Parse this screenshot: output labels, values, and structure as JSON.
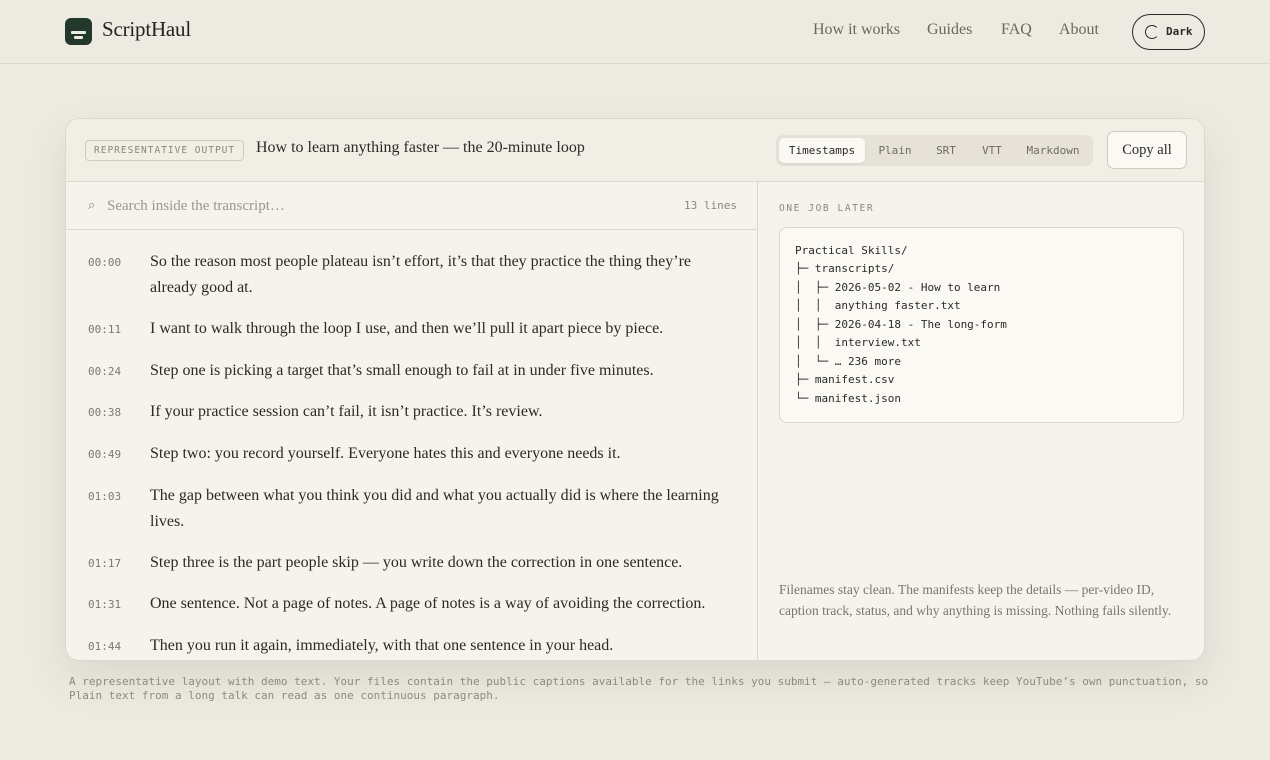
{
  "brand": {
    "name": "ScriptHaul"
  },
  "nav": {
    "how_it_works": "How it works",
    "guides": "Guides",
    "faq": "FAQ",
    "about": "About",
    "theme_toggle": "Dark"
  },
  "panel": {
    "badge": "REPRESENTATIVE OUTPUT",
    "title": "How to learn anything faster — the 20-minute loop",
    "formats": [
      "Timestamps",
      "Plain",
      "SRT",
      "VTT",
      "Markdown"
    ],
    "active_format": "Timestamps",
    "copy_all": "Copy all"
  },
  "search": {
    "placeholder": "Search inside the transcript…",
    "line_count": "13 lines"
  },
  "transcript": [
    {
      "time": "00:00",
      "text": "So the reason most people plateau isn’t effort, it’s that they practice the thing they’re already good at."
    },
    {
      "time": "00:11",
      "text": "I want to walk through the loop I use, and then we’ll pull it apart piece by piece."
    },
    {
      "time": "00:24",
      "text": "Step one is picking a target that’s small enough to fail at in under five minutes."
    },
    {
      "time": "00:38",
      "text": "If your practice session can’t fail, it isn’t practice. It’s review."
    },
    {
      "time": "00:49",
      "text": "Step two: you record yourself. Everyone hates this and everyone needs it."
    },
    {
      "time": "01:03",
      "text": "The gap between what you think you did and what you actually did is where the learning lives."
    },
    {
      "time": "01:17",
      "text": "Step three is the part people skip — you write down the correction in one sentence."
    },
    {
      "time": "01:31",
      "text": "One sentence. Not a page of notes. A page of notes is a way of avoiding the correction."
    },
    {
      "time": "01:44",
      "text": "Then you run it again, immediately, with that one sentence in your head."
    }
  ],
  "side": {
    "label": "ONE JOB LATER",
    "tree": [
      "Practical Skills/",
      "├─ transcripts/",
      "│  ├─ 2026-05-02 - How to learn",
      "│  │  anything faster.txt",
      "│  ├─ 2026-04-18 - The long-form",
      "│  │  interview.txt",
      "│  └─ … 236 more",
      "├─ manifest.csv",
      "└─ manifest.json"
    ],
    "note": "Filenames stay clean. The manifests keep the details — per-video ID, caption track, status, and why anything is missing. Nothing fails silently."
  },
  "footnote": "A representative layout with demo text. Your files contain the public captions available for the links you submit — auto-generated tracks keep YouTube’s own punctuation, so Plain text from a long talk can read as one continuous paragraph.",
  "colors": {
    "background": "#edeae1",
    "brand_green": "#23382c",
    "card": "#f6f3ec"
  },
  "icons": [
    "document-logo-icon",
    "half-moon-icon",
    "search-icon"
  ]
}
